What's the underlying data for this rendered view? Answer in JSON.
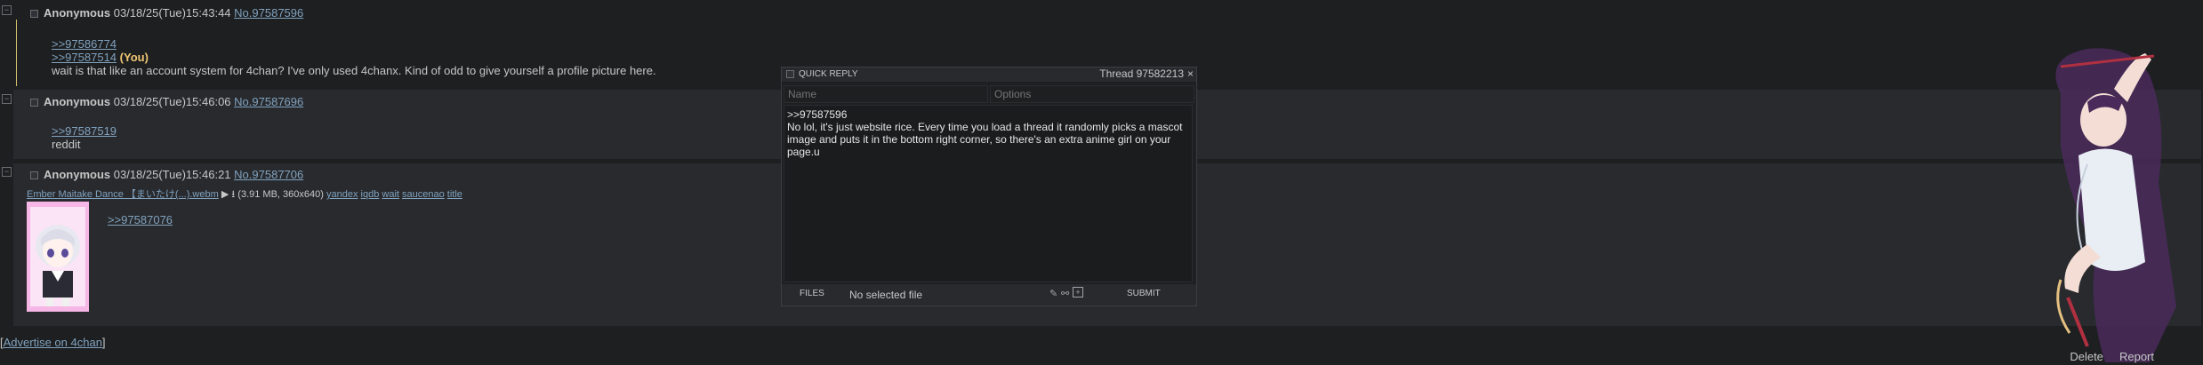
{
  "posts": [
    {
      "name": "Anonymous",
      "datetime": "03/18/25(Tue)15:43:44",
      "number": "No.97587596",
      "quotes": [
        ">>97586774",
        ">>97587514"
      ],
      "you_tag": "(You)",
      "text": "wait is that like an account system for 4chan? I've only used 4chanx. Kind of odd to give yourself a profile picture here."
    },
    {
      "name": "Anonymous",
      "datetime": "03/18/25(Tue)15:46:06",
      "number": "No.97587696",
      "quotes": [
        ">>97587519"
      ],
      "text": "reddit"
    },
    {
      "name": "Anonymous",
      "datetime": "03/18/25(Tue)15:46:21",
      "number": "No.97587706",
      "file": {
        "name": "Ember Maitake Dance 【まいたけ(...).webm",
        "meta": "(3.91 MB, 360x640)",
        "search_links": [
          "yandex",
          "iqdb",
          "wait",
          "saucenao",
          "title"
        ]
      },
      "quotes": [
        ">>97587076"
      ]
    }
  ],
  "quick_reply": {
    "title": "QUICK REPLY",
    "thread": "Thread 97582213",
    "close": "×",
    "name_placeholder": "Name",
    "options_placeholder": "Options",
    "comment": ">>97587596\nNo lol, it's just website rice. Every time you load a thread it randomly picks a mascot image and puts it in the bottom right corner, so there's an extra anime girl on your page.u",
    "files_label": "FILES",
    "no_file": "No selected file",
    "submit": "SUBMIT"
  },
  "footer": {
    "advertise": "Advertise on 4chan",
    "delete": "Delete",
    "report": "Report"
  }
}
